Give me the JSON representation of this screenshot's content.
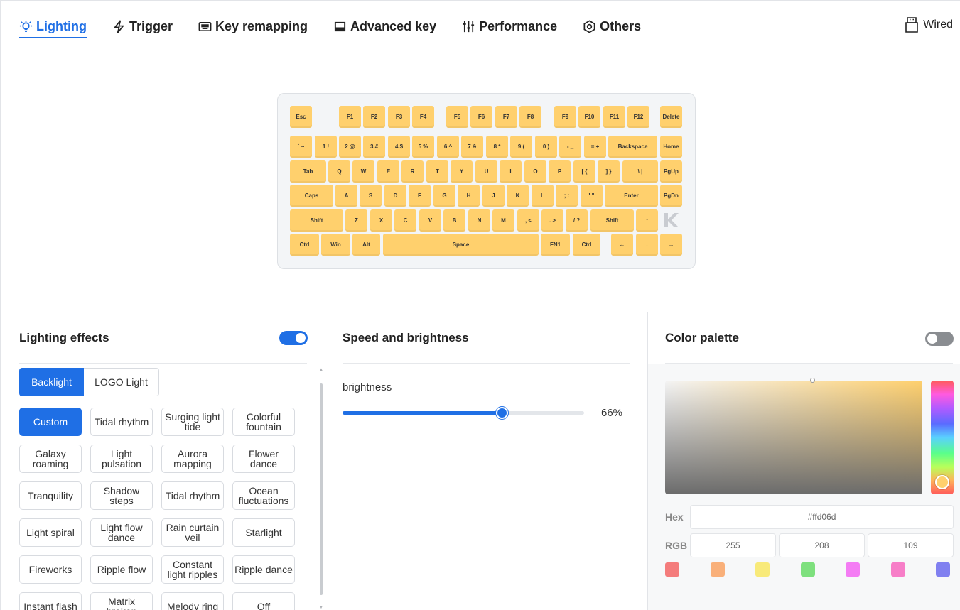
{
  "nav": {
    "tabs": [
      {
        "label": "Lighting",
        "icon": "lightbulb-icon",
        "active": true
      },
      {
        "label": "Trigger",
        "icon": "bolt-icon",
        "active": false
      },
      {
        "label": "Key remapping",
        "icon": "keyboard-icon",
        "active": false
      },
      {
        "label": "Advanced key",
        "icon": "advanced-key-icon",
        "active": false
      },
      {
        "label": "Performance",
        "icon": "sliders-icon",
        "active": false
      },
      {
        "label": "Others",
        "icon": "hexagon-gear-icon",
        "active": false
      }
    ],
    "connection": {
      "label": "Wired",
      "icon": "usb-plug-icon"
    }
  },
  "keyboard": {
    "key_color": "#ffd06d",
    "rows": [
      [
        "Esc",
        "F1",
        "F2",
        "F3",
        "F4",
        "F5",
        "F6",
        "F7",
        "F8",
        "F9",
        "F10",
        "F11",
        "F12",
        "Delete"
      ],
      [
        "` ~",
        "1 !",
        "2 @",
        "3 #",
        "4 $",
        "5 %",
        "6 ^",
        "7 &",
        "8 *",
        "9 (",
        "0 )",
        "- _",
        "= +",
        "Backspace",
        "Home"
      ],
      [
        "Tab",
        "Q",
        "W",
        "E",
        "R",
        "T",
        "Y",
        "U",
        "I",
        "O",
        "P",
        "[ {",
        "] }",
        "\\ |",
        "PgUp"
      ],
      [
        "Caps",
        "A",
        "S",
        "D",
        "F",
        "G",
        "H",
        "J",
        "K",
        "L",
        "; :",
        "' \"",
        "Enter",
        "PgDn"
      ],
      [
        "Shift",
        "Z",
        "X",
        "C",
        "V",
        "B",
        "N",
        "M",
        ", <",
        ". >",
        "/ ?",
        "Shift",
        "↑"
      ],
      [
        "Ctrl",
        "Win",
        "Alt",
        "Space",
        "FN1",
        "Ctrl",
        "←",
        "↓",
        "→"
      ]
    ],
    "logo_icon": "brand-k-logo-icon"
  },
  "lighting_effects": {
    "title": "Lighting effects",
    "enabled": true,
    "modes": [
      "Backlight",
      "LOGO Light"
    ],
    "active_mode": "Backlight",
    "effects": [
      "Custom",
      "Tidal rhythm",
      "Surging light tide",
      "Colorful fountain",
      "Galaxy roaming",
      "Light pulsation",
      "Aurora mapping",
      "Flower dance",
      "Tranquility",
      "Shadow steps",
      "Tidal rhythm",
      "Ocean fluctuations",
      "Light spiral",
      "Light flow dance",
      "Rain curtain veil",
      "Starlight",
      "Fireworks",
      "Ripple flow",
      "Constant light ripples",
      "Ripple dance",
      "Instant flash",
      "Matrix broken",
      "Melody ring",
      "Off"
    ],
    "active_effect": "Custom"
  },
  "speed_brightness": {
    "title": "Speed and brightness",
    "brightness_label": "brightness",
    "brightness_value": 66,
    "brightness_text": "66%"
  },
  "color_palette": {
    "title": "Color palette",
    "enabled": false,
    "hex_label": "Hex",
    "hex_value": "#ffd06d",
    "rgb_label": "RGB",
    "r": "255",
    "g": "208",
    "b": "109",
    "swatches": [
      "#f47c7c",
      "#f9b07a",
      "#f8ea7a",
      "#7ee07e",
      "#f47cf4",
      "#f77ec8",
      "#8080f0"
    ]
  },
  "accent_color": "#1f6fe5"
}
